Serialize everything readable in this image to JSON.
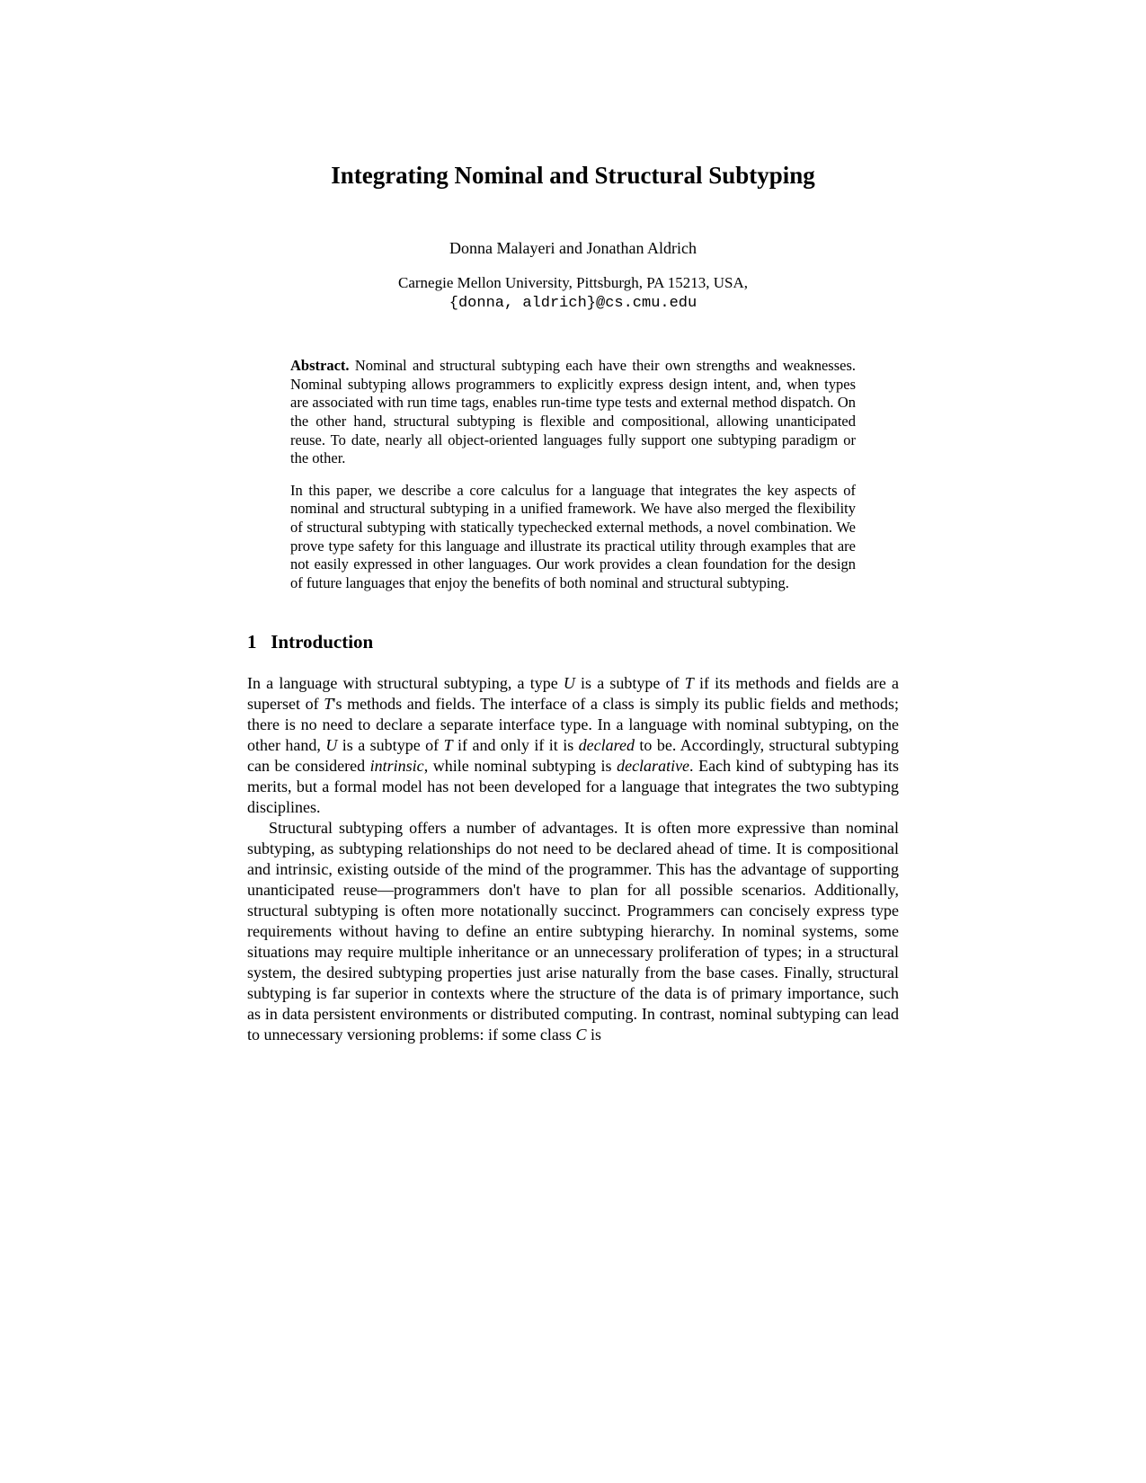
{
  "title": "Integrating Nominal and Structural Subtyping",
  "authors": "Donna Malayeri and Jonathan Aldrich",
  "affiliation": "Carnegie Mellon University, Pittsburgh, PA 15213, USA,",
  "email": "{donna, aldrich}@cs.cmu.edu",
  "abstract": {
    "label": "Abstract.",
    "p1": " Nominal and structural subtyping each have their own strengths and weaknesses. Nominal subtyping allows programmers to explicitly express design intent, and, when types are associated with run time tags, enables run-time type tests and external method dispatch. On the other hand, structural subtyping is flexible and compositional, allowing unanticipated reuse. To date, nearly all object-oriented languages fully support one subtyping paradigm or the other.",
    "p2": "In this paper, we describe a core calculus for a language that integrates the key aspects of nominal and structural subtyping in a unified framework. We have also merged the flexibility of structural subtyping with statically typechecked external methods, a novel combination. We prove type safety for this language and illustrate its practical utility through examples that are not easily expressed in other languages. Our work provides a clean foundation for the design of future languages that enjoy the benefits of both nominal and structural subtyping."
  },
  "section1": {
    "number": "1",
    "title": "Introduction"
  },
  "body": {
    "p1_a": "In a language with structural subtyping, a type ",
    "p1_u1": "U",
    "p1_b": " is a subtype of ",
    "p1_t1": "T",
    "p1_c": " if its methods and fields are a superset of ",
    "p1_t2": "T",
    "p1_d": "'s methods and fields. The interface of a class is simply its public fields and methods; there is no need to declare a separate interface type. In a language with nominal subtyping, on the other hand, ",
    "p1_u2": "U",
    "p1_e": " is a subtype of ",
    "p1_t3": "T",
    "p1_f": " if and only if it is ",
    "p1_decl": "declared",
    "p1_g": " to be. Accordingly, structural subtyping can be considered ",
    "p1_intr": "intrinsic",
    "p1_h": ", while nominal subtyping is ",
    "p1_decl2": "declarative",
    "p1_i": ". Each kind of subtyping has its merits, but a formal model has not been developed for a language that integrates the two subtyping disciplines.",
    "p2_a": "Structural subtyping offers a number of advantages. It is often more expressive than nominal subtyping, as subtyping relationships do not need to be declared ahead of time. It is compositional and intrinsic, existing outside of the mind of the programmer. This has the advantage of supporting unanticipated reuse—programmers don't have to plan for all possible scenarios. Additionally, structural subtyping is often more notationally succinct. Programmers can concisely express type requirements without having to define an entire subtyping hierarchy. In nominal systems, some situations may require multiple inheritance or an unnecessary proliferation of types; in a structural system, the desired subtyping properties just arise naturally from the base cases. Finally, structural subtyping is far superior in contexts where the structure of the data is of primary importance, such as in data persistent environments or distributed computing. In contrast, nominal subtyping can lead to unnecessary versioning problems: if some class ",
    "p2_c": "C",
    "p2_b": " is"
  }
}
